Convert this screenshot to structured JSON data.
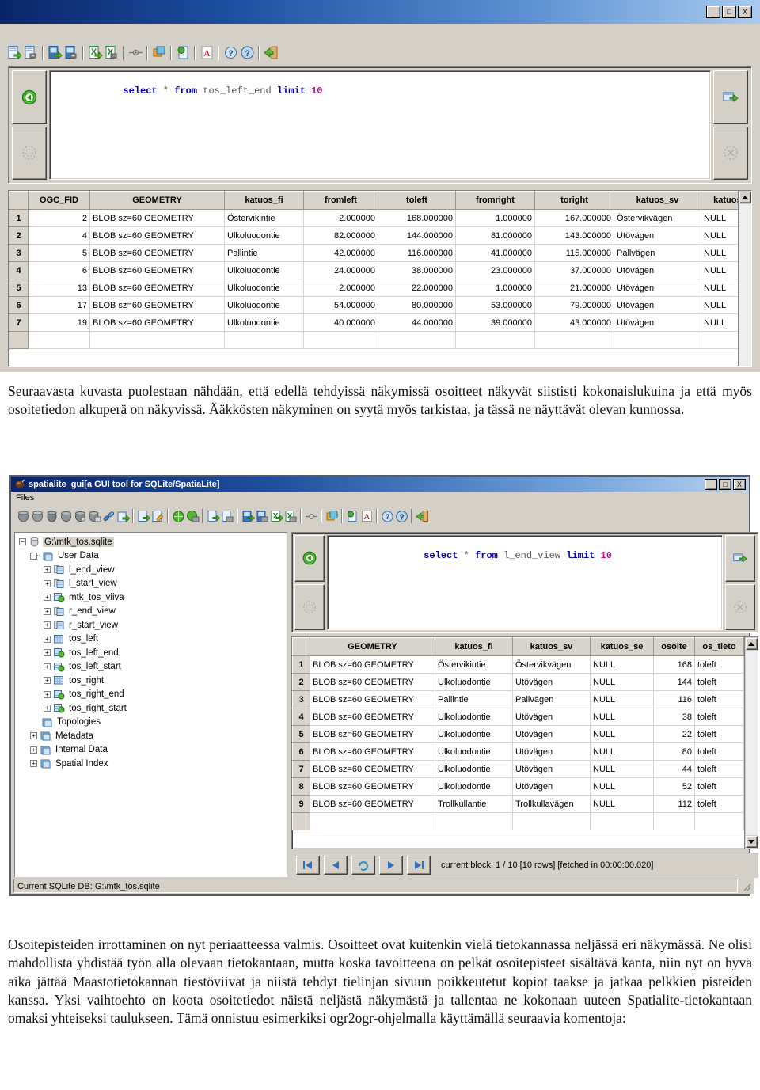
{
  "window_top": {
    "window_controls": [
      "_",
      "□",
      "X"
    ],
    "toolbar_icons": [
      "load-shapefile-icon",
      "save-shapefile-icon",
      "load-dbf-icon",
      "save-dbf-icon",
      "load-xls-icon",
      "save-xls-icon",
      "network-icon",
      "vacuum-icon",
      "srid-icon",
      "font-icon",
      "about-icon",
      "help-icon",
      "exit-icon"
    ],
    "editor": {
      "exec_button_icon": "execute-green-arrow-icon",
      "clear_button_icon": "clear-disabled-icon",
      "export_button_icon": "export-green-arrow-icon",
      "stop_button_icon": "stop-disabled-icon",
      "sql": {
        "tokens": [
          {
            "t": "select",
            "c": "kw"
          },
          {
            "t": " ",
            "c": "plain"
          },
          {
            "t": "*",
            "c": "star"
          },
          {
            "t": " ",
            "c": "plain"
          },
          {
            "t": "from",
            "c": "kw"
          },
          {
            "t": " ",
            "c": "plain"
          },
          {
            "t": "tos_left_end",
            "c": "ident"
          },
          {
            "t": " ",
            "c": "plain"
          },
          {
            "t": "limit",
            "c": "kw"
          },
          {
            "t": " ",
            "c": "plain"
          },
          {
            "t": "10",
            "c": "num"
          }
        ],
        "text": "select * from tos_left_end limit 10"
      }
    },
    "table": {
      "columns": [
        "OGC_FID",
        "GEOMETRY",
        "katuos_fi",
        "fromleft",
        "toleft",
        "fromright",
        "toright",
        "katuos_sv",
        "katuos_se"
      ],
      "rows": [
        {
          "n": "1",
          "cells": [
            "2",
            "BLOB sz=60 GEOMETRY",
            "Östervikintie",
            "2.000000",
            "168.000000",
            "1.000000",
            "167.000000",
            "Östervikvägen",
            "NULL"
          ]
        },
        {
          "n": "2",
          "cells": [
            "4",
            "BLOB sz=60 GEOMETRY",
            "Ulkoluodontie",
            "82.000000",
            "144.000000",
            "81.000000",
            "143.000000",
            "Utövägen",
            "NULL"
          ]
        },
        {
          "n": "3",
          "cells": [
            "5",
            "BLOB sz=60 GEOMETRY",
            "Pallintie",
            "42.000000",
            "116.000000",
            "41.000000",
            "115.000000",
            "Pallvägen",
            "NULL"
          ]
        },
        {
          "n": "4",
          "cells": [
            "6",
            "BLOB sz=60 GEOMETRY",
            "Ulkoluodontie",
            "24.000000",
            "38.000000",
            "23.000000",
            "37.000000",
            "Utövägen",
            "NULL"
          ]
        },
        {
          "n": "5",
          "cells": [
            "13",
            "BLOB sz=60 GEOMETRY",
            "Ulkoluodontie",
            "2.000000",
            "22.000000",
            "1.000000",
            "21.000000",
            "Utövägen",
            "NULL"
          ]
        },
        {
          "n": "6",
          "cells": [
            "17",
            "BLOB sz=60 GEOMETRY",
            "Ulkoluodontie",
            "54.000000",
            "80.000000",
            "53.000000",
            "79.000000",
            "Utövägen",
            "NULL"
          ]
        },
        {
          "n": "7",
          "cells": [
            "19",
            "BLOB sz=60 GEOMETRY",
            "Ulkoluodontie",
            "40.000000",
            "44.000000",
            "39.000000",
            "43.000000",
            "Utövägen",
            "NULL"
          ]
        }
      ]
    }
  },
  "paragraph_1": "Seuraavasta kuvasta puolestaan nähdään, että edellä tehdyissä näkymissä osoitteet näkyvät siististi kokonaislukuina ja että myös osoitetiedon alkuperä on näkyvissä.  Ääkkösten näkyminen on syytä myös tarkistaa, ja tässä ne näyttävät olevan kunnossa.",
  "window_bottom": {
    "title": "spatialite_gui",
    "title_sub": "[a GUI tool for SQLite/SpatiaLite]",
    "title_icon": "spatialite-app-icon",
    "window_controls": [
      "_",
      "□",
      "X"
    ],
    "menu": [
      {
        "label": "Files",
        "accel": "F"
      }
    ],
    "toolbar_icons": [
      "connect-db-icon",
      "create-db-icon",
      "close-db-icon",
      "memory-db-icon",
      "load-memory-icon",
      "save-memory-icon",
      "attach-db-icon",
      "vacuum-icon",
      "load-sql-icon",
      "compose-sql-icon",
      "load-shp-icon",
      "save-shp-icon",
      "load-txt-icon",
      "save-txt-icon",
      "load-dbf-icon",
      "save-dbf-icon",
      "load-xls-icon",
      "save-xls-icon",
      "network-icon",
      "srid-icon",
      "charset-icon",
      "font-icon",
      "about-icon",
      "help-icon",
      "exit-icon"
    ],
    "tree": {
      "root": "G:\\mtk_tos.sqlite",
      "root_icon": "database-icon",
      "items": [
        {
          "label": "User Data",
          "depth": 1,
          "expander": "-",
          "icon": "folder-icon"
        },
        {
          "label": "l_end_view",
          "depth": 2,
          "expander": "+",
          "icon": "view-icon"
        },
        {
          "label": "l_start_view",
          "depth": 2,
          "expander": "+",
          "icon": "view-icon"
        },
        {
          "label": "mtk_tos_viiva",
          "depth": 2,
          "expander": "+",
          "icon": "geotable-icon"
        },
        {
          "label": "r_end_view",
          "depth": 2,
          "expander": "+",
          "icon": "view-icon"
        },
        {
          "label": "r_start_view",
          "depth": 2,
          "expander": "+",
          "icon": "view-icon"
        },
        {
          "label": "tos_left",
          "depth": 2,
          "expander": "+",
          "icon": "table-icon"
        },
        {
          "label": "tos_left_end",
          "depth": 2,
          "expander": "+",
          "icon": "geotable-icon"
        },
        {
          "label": "tos_left_start",
          "depth": 2,
          "expander": "+",
          "icon": "geotable-icon"
        },
        {
          "label": "tos_right",
          "depth": 2,
          "expander": "+",
          "icon": "table-icon"
        },
        {
          "label": "tos_right_end",
          "depth": 2,
          "expander": "+",
          "icon": "geotable-icon"
        },
        {
          "label": "tos_right_start",
          "depth": 2,
          "expander": "+",
          "icon": "geotable-icon"
        },
        {
          "label": "Topologies",
          "depth": 1,
          "expander": "",
          "icon": "folder-icon"
        },
        {
          "label": "Metadata",
          "depth": 1,
          "expander": "+",
          "icon": "folder-icon"
        },
        {
          "label": "Internal Data",
          "depth": 1,
          "expander": "+",
          "icon": "folder-icon"
        },
        {
          "label": "Spatial Index",
          "depth": 1,
          "expander": "+",
          "icon": "folder-icon"
        }
      ]
    },
    "editor": {
      "sql": {
        "tokens": [
          {
            "t": "select",
            "c": "kw"
          },
          {
            "t": " ",
            "c": "plain"
          },
          {
            "t": "*",
            "c": "star"
          },
          {
            "t": " ",
            "c": "plain"
          },
          {
            "t": "from",
            "c": "kw"
          },
          {
            "t": " ",
            "c": "plain"
          },
          {
            "t": "l_end_view",
            "c": "ident"
          },
          {
            "t": " ",
            "c": "plain"
          },
          {
            "t": "limit",
            "c": "kw"
          },
          {
            "t": " ",
            "c": "plain"
          },
          {
            "t": "10",
            "c": "num"
          }
        ],
        "text": "select * from l_end_view limit 10"
      }
    },
    "table": {
      "columns": [
        "GEOMETRY",
        "katuos_fi",
        "katuos_sv",
        "katuos_se",
        "osoite",
        "os_tieto"
      ],
      "rows": [
        {
          "n": "1",
          "cells": [
            "BLOB sz=60 GEOMETRY",
            "Östervikintie",
            "Östervikvägen",
            "NULL",
            "168",
            "toleft"
          ]
        },
        {
          "n": "2",
          "cells": [
            "BLOB sz=60 GEOMETRY",
            "Ulkoluodontie",
            "Utövägen",
            "NULL",
            "144",
            "toleft"
          ]
        },
        {
          "n": "3",
          "cells": [
            "BLOB sz=60 GEOMETRY",
            "Pallintie",
            "Pallvägen",
            "NULL",
            "116",
            "toleft"
          ]
        },
        {
          "n": "4",
          "cells": [
            "BLOB sz=60 GEOMETRY",
            "Ulkoluodontie",
            "Utövägen",
            "NULL",
            "38",
            "toleft"
          ]
        },
        {
          "n": "5",
          "cells": [
            "BLOB sz=60 GEOMETRY",
            "Ulkoluodontie",
            "Utövägen",
            "NULL",
            "22",
            "toleft"
          ]
        },
        {
          "n": "6",
          "cells": [
            "BLOB sz=60 GEOMETRY",
            "Ulkoluodontie",
            "Utövägen",
            "NULL",
            "80",
            "toleft"
          ]
        },
        {
          "n": "7",
          "cells": [
            "BLOB sz=60 GEOMETRY",
            "Ulkoluodontie",
            "Utövägen",
            "NULL",
            "44",
            "toleft"
          ]
        },
        {
          "n": "8",
          "cells": [
            "BLOB sz=60 GEOMETRY",
            "Ulkoluodontie",
            "Utövägen",
            "NULL",
            "52",
            "toleft"
          ]
        },
        {
          "n": "9",
          "cells": [
            "BLOB sz=60 GEOMETRY",
            "Trollkullantie",
            "Trollkullavägen",
            "NULL",
            "112",
            "toleft"
          ]
        }
      ]
    },
    "nav": {
      "buttons": [
        "first-record-icon",
        "previous-record-icon",
        "refresh-icon",
        "next-record-icon",
        "last-record-icon"
      ],
      "status": "current block: 1 / 10 [10 rows]    [fetched in 00:00:00.020]"
    },
    "statusbar": "Current SQLite DB: G:\\mtk_tos.sqlite"
  },
  "paragraph_2": "Osoitepisteiden irrottaminen on nyt periaatteessa valmis.  Osoitteet ovat kuitenkin vielä tietokannassa neljässä eri näkymässä.  Ne olisi mahdollista yhdistää työn alla olevaan tietokantaan, mutta koska tavoitteena on pelkät osoitepisteet sisältävä kanta, niin nyt on hyvä aika jättää Maastotietokannan tiestöviivat ja niistä tehdyt tielinjan sivuun poikkeutetut kopiot taakse ja jatkaa pelkkien pisteiden kanssa.  Yksi vaihtoehto on koota osoitetiedot näistä neljästä näkymästä ja tallentaa ne kokonaan uuteen Spatialite-tietokantaan omaksi yhteiseksi taulukseen.  Tämä onnistuu esimerkiksi ogr2ogr-ohjelmalla käyttämällä seuraavia komentoja:"
}
